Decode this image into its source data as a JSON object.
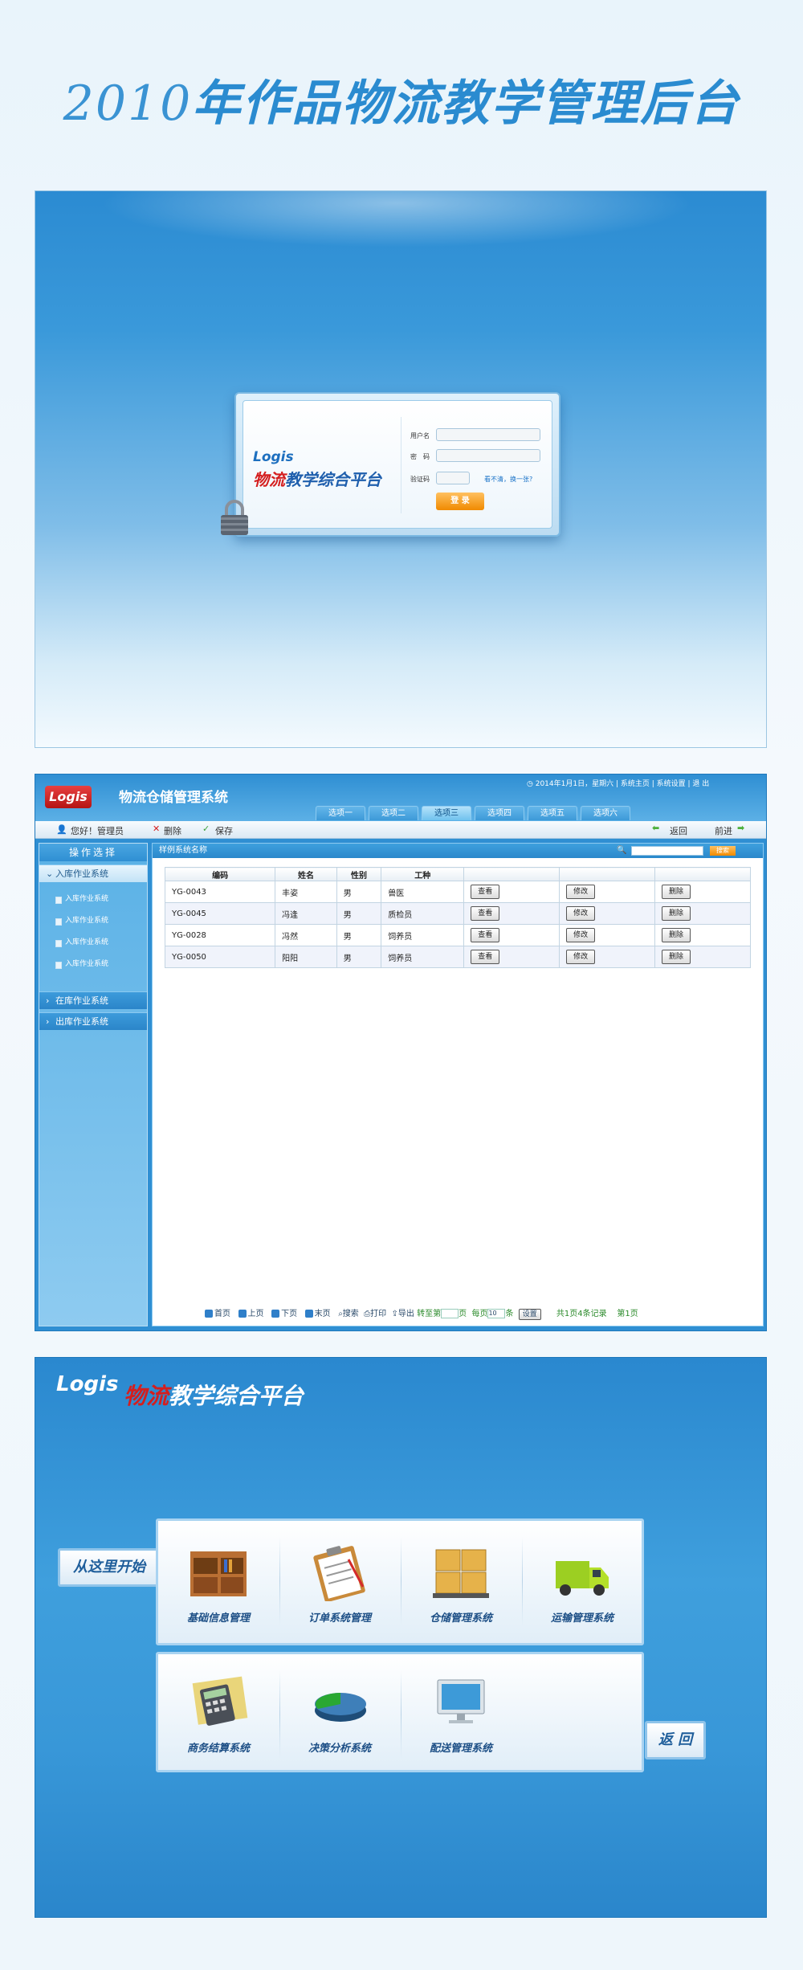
{
  "page_title": {
    "year": "2010",
    "rest": "年作品物流教学管理后台"
  },
  "login": {
    "logo": "Logis",
    "brand_red": "物流",
    "brand_blue": "教学综合平台",
    "username_label": "用户名",
    "password_label": "密　码",
    "captcha_label": "验证码",
    "captcha_hint": "看不清，换一张?",
    "submit_label": "登 录"
  },
  "admin": {
    "logo": "Logis",
    "system_title": "物流仓储管理系统",
    "top_bar": {
      "date": "2014年1月1日，星期六",
      "links": [
        "系统主页",
        "系统设置",
        "退 出"
      ]
    },
    "tabs": [
      "选项一",
      "选项二",
      "选项三",
      "选项四",
      "选项五",
      "选项六"
    ],
    "active_tab": 2,
    "toolbar": {
      "greeting": "您好！管理员",
      "delete": "删除",
      "save": "保存",
      "back": "返回",
      "forward": "前进"
    },
    "sidebar": {
      "header": "操作选择",
      "group_open": "入库作业系统",
      "items": [
        "入库作业系统",
        "入库作业系统",
        "入库作业系统",
        "入库作业系统"
      ],
      "groups": [
        "在库作业系统",
        "出库作业系统"
      ]
    },
    "main": {
      "header": "样例系统名称",
      "search_button": "搜索",
      "columns": [
        "编码",
        "姓名",
        "性别",
        "工种",
        "",
        "",
        ""
      ],
      "rows": [
        {
          "code": "YG-0043",
          "name": "丰姿",
          "gender": "男",
          "job": "兽医"
        },
        {
          "code": "YG-0045",
          "name": "冯逢",
          "gender": "男",
          "job": "质检员"
        },
        {
          "code": "YG-0028",
          "name": "冯然",
          "gender": "男",
          "job": "饲养员"
        },
        {
          "code": "YG-0050",
          "name": "阳阳",
          "gender": "男",
          "job": "饲养员"
        }
      ],
      "row_actions": [
        "查看",
        "修改",
        "删除"
      ]
    },
    "pager": {
      "first": "首页",
      "prev": "上页",
      "next": "下页",
      "last": "末页",
      "search": "搜索",
      "print": "打印",
      "export": "导出",
      "goto": "转至第",
      "page_unit": "页",
      "per_page": "每页",
      "per_page_value": "10",
      "item_unit": "条",
      "set": "设置",
      "total_pages": "共1页",
      "total_records": "4条记录",
      "current": "第1页"
    }
  },
  "portal": {
    "logo": "Logis",
    "brand_red": "物流",
    "brand_white": "教学综合平台",
    "start_label": "从这里开始",
    "back_label": "返 回",
    "modules_row1": [
      "基础信息管理",
      "订单系统管理",
      "仓储管理系统",
      "运输管理系统"
    ],
    "modules_row2": [
      "商务结算系统",
      "决策分析系统",
      "配送管理系统"
    ]
  },
  "colors": {
    "accent": "#2a8bd0",
    "panel_blue": "#2f8fd3",
    "red": "#d41e1e",
    "button_orange": "#f08a00"
  }
}
